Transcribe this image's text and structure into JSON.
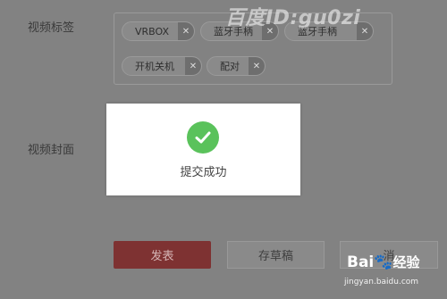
{
  "form": {
    "tags_label": "视频标签",
    "cover_label": "视频封面",
    "tags": [
      "VRBOX",
      "蓝牙手柄",
      "蓝牙手柄",
      "开机关机",
      "配对"
    ]
  },
  "actions": {
    "publish_label": "发表",
    "draft_label": "存草稿",
    "cancel_label": "消"
  },
  "modal": {
    "message": "提交成功"
  },
  "watermark": {
    "text": "百度ID:gu0zi"
  },
  "footer": {
    "brand": "Bai",
    "brand_suffix": "经验",
    "url": "jingyan.baidu.com"
  },
  "colors": {
    "overlay": "#828282",
    "success": "#5ac25b",
    "publish_button": "#7e3232"
  }
}
